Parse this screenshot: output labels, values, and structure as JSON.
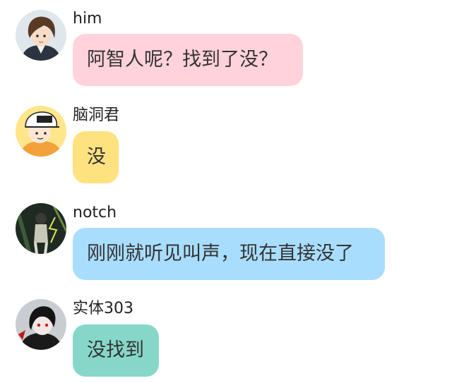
{
  "messages": [
    {
      "sender": "him",
      "avatar": "anime-boy-avatar",
      "text": "阿智人呢？找到了没？",
      "bubble_color": "#FFD2DC"
    },
    {
      "sender": "脑洞君",
      "avatar": "cap-character-avatar",
      "text": "没",
      "bubble_color": "#FFE280"
    },
    {
      "sender": "notch",
      "avatar": "dark-figure-avatar",
      "text": "刚刚就听见叫声，现在直接没了",
      "bubble_color": "#A9DDFD"
    },
    {
      "sender": "实体303",
      "avatar": "red-eyed-character-avatar",
      "text": "没找到",
      "bubble_color": "#86D7C9"
    }
  ]
}
